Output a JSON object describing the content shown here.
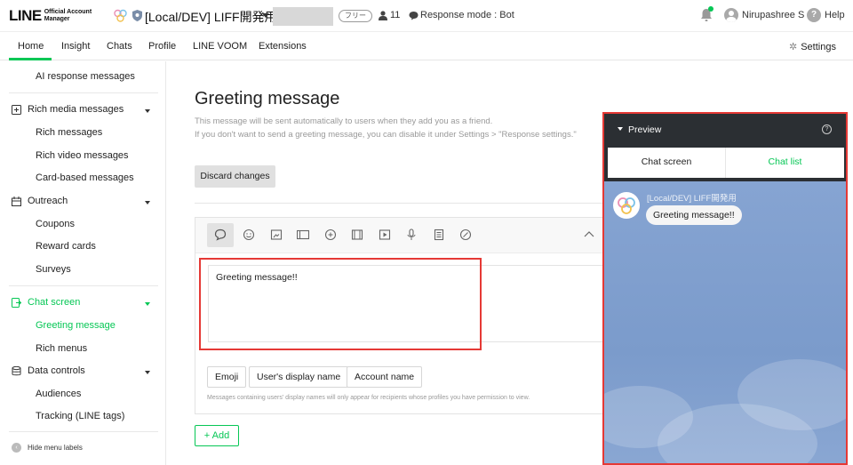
{
  "header": {
    "logo_main": "LINE",
    "logo_sub_1": "Official Account",
    "logo_sub_2": "Manager",
    "account_name": "[Local/DEV] LIFF開発用",
    "plan_badge": "フリー",
    "friends_count": "11",
    "response_mode": "Response mode : Bot",
    "user_name": "Nirupashree S",
    "help_label": "Help"
  },
  "nav": {
    "tabs": [
      "Home",
      "Insight",
      "Chats",
      "Profile",
      "LINE VOOM",
      "Extensions"
    ],
    "settings_label": "Settings"
  },
  "sidebar": {
    "ai_response": "AI response messages",
    "rich_media": "Rich media messages",
    "rich_messages": "Rich messages",
    "rich_video": "Rich video messages",
    "card_based": "Card-based messages",
    "outreach": "Outreach",
    "coupons": "Coupons",
    "reward_cards": "Reward cards",
    "surveys": "Surveys",
    "chat_screen": "Chat screen",
    "greeting_message": "Greeting message",
    "rich_menus": "Rich menus",
    "data_controls": "Data controls",
    "audiences": "Audiences",
    "tracking": "Tracking (LINE tags)",
    "hide_labels": "Hide menu labels"
  },
  "main": {
    "title": "Greeting message",
    "desc_1": "This message will be sent automatically to users when they add you as a friend.",
    "desc_2": "If you don't want to send a greeting message, you can disable it under Settings > \"Response settings.\"",
    "discard": "Discard changes",
    "message_text": "Greeting message!!",
    "chips": [
      "Emoji",
      "User's display name",
      "Account name"
    ],
    "note": "Messages containing users' display names will only appear for recipients whose profiles you have permission to view.",
    "add": "+ Add"
  },
  "preview": {
    "title": "Preview",
    "help_glyph": "?",
    "tab_chat_screen": "Chat screen",
    "tab_chat_list": "Chat list",
    "sender": "[Local/DEV] LIFF開発用",
    "bubble": "Greeting message!!"
  },
  "colors": {
    "accent": "#06c755",
    "highlight_border": "#e53935",
    "preview_bg": "#7f9fcc",
    "preview_header": "#2b2f33"
  }
}
